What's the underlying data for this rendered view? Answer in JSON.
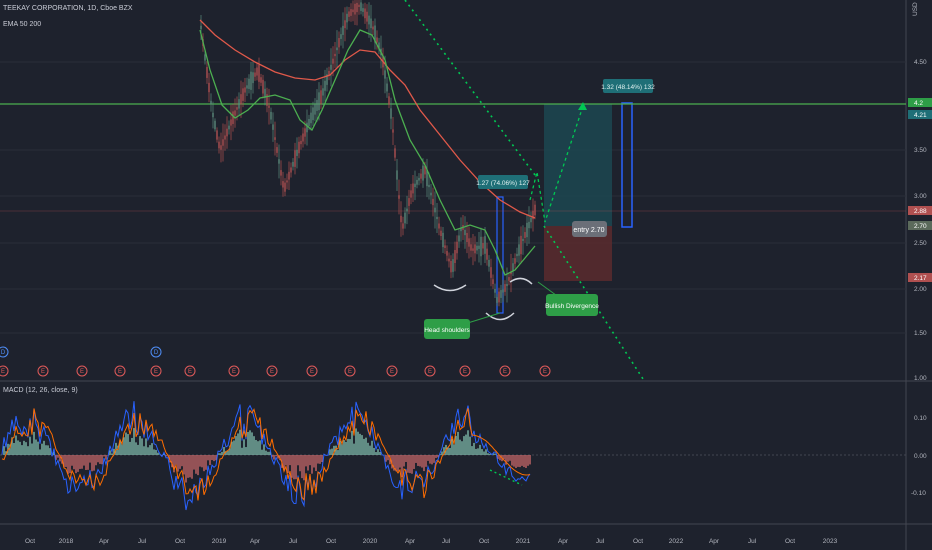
{
  "header": {
    "symbol_line": "TEEKAY CORPORATION, 1D, Cboe BZX",
    "ema_line": "EMA 50 200",
    "macd_line": "MACD (12, 26, close, 9)",
    "currency": "USD"
  },
  "price_axis": {
    "labels": [
      "4.50",
      "3.50",
      "3.00",
      "2.50",
      "2.00",
      "1.50",
      "1.00"
    ],
    "badges": [
      "4.2",
      "4.21",
      "2.88",
      "2.70",
      "2.17"
    ]
  },
  "macd_axis": {
    "labels": [
      "0.10",
      "0.00",
      "-0.10"
    ]
  },
  "time_axis": {
    "labels": [
      "Oct",
      "2018",
      "Apr",
      "Jul",
      "Oct",
      "2019",
      "Apr",
      "Jul",
      "Oct",
      "2020",
      "Apr",
      "Jul",
      "Oct",
      "2021",
      "Apr",
      "Jul",
      "Oct",
      "2022",
      "Apr",
      "Jul",
      "Oct",
      "2023"
    ]
  },
  "annotations": {
    "target_box": "1.32 (48.14%) 132",
    "measure_box": "1.27 (74.06%) 127",
    "entry_label": "entry 2.70",
    "head_shoulders": "Head shoulders",
    "bullish_divergence": "Bullish Divergence"
  },
  "markers": {
    "dividend": "D",
    "earnings": "E"
  },
  "colors": {
    "background": "#1e222d",
    "green_line": "#4caf50",
    "candle_up": "#5a8a7a",
    "candle_down": "#b05050",
    "ema50": "#4caf50",
    "ema200": "#e0594a",
    "macd_line": "#2962ff",
    "signal_line": "#ff6d00",
    "projection": "#00c853",
    "target_zone": "#1c4a52",
    "stop_zone": "#5a2a2e",
    "label_green": "#2e9e47",
    "badge_teal": "#1f6f77"
  }
}
